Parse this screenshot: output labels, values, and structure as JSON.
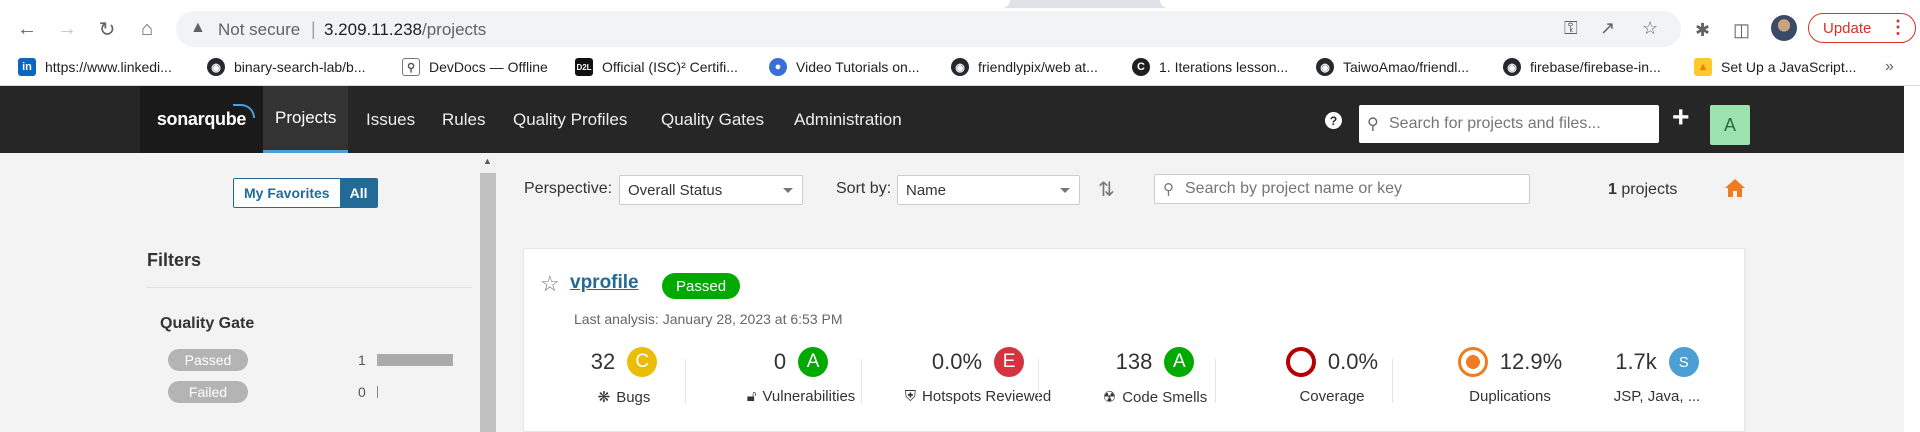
{
  "browser": {
    "security_text": "Not secure",
    "url_host": "3.209.11.238",
    "url_path": "/projects",
    "update_label": "Update"
  },
  "bookmarks": [
    {
      "label": "https://www.linkedi...",
      "icon": "linkedin-icon"
    },
    {
      "label": "binary-search-lab/b...",
      "icon": "github-icon"
    },
    {
      "label": "DevDocs — Offline",
      "icon": "devdocs-icon"
    },
    {
      "label": "Official (ISC)² Certifi...",
      "icon": "d2l-icon"
    },
    {
      "label": "Video Tutorials on...",
      "icon": "globe-icon"
    },
    {
      "label": "friendlypix/web at...",
      "icon": "github-icon"
    },
    {
      "label": "1. Iterations lesson...",
      "icon": "codecademy-icon"
    },
    {
      "label": "TaiwoAmao/friendl...",
      "icon": "github-icon"
    },
    {
      "label": "firebase/firebase-in...",
      "icon": "github-icon"
    },
    {
      "label": "Set Up a JavaScript...",
      "icon": "firebase-icon"
    }
  ],
  "nav": {
    "logo": "sonarqube",
    "items": [
      "Projects",
      "Issues",
      "Rules",
      "Quality Profiles",
      "Quality Gates",
      "Administration"
    ],
    "active": "Projects",
    "search_placeholder": "Search for projects and files...",
    "avatar_letter": "A"
  },
  "sidebar": {
    "favorites_label": "My Favorites",
    "all_label": "All",
    "filters_title": "Filters",
    "quality_gate_title": "Quality Gate",
    "facets": [
      {
        "label": "Passed",
        "count": "1",
        "fraction": 1.0
      },
      {
        "label": "Failed",
        "count": "0",
        "fraction": 0.0
      }
    ]
  },
  "controls": {
    "perspective_label": "Perspective:",
    "perspective_value": "Overall Status",
    "sort_label": "Sort by:",
    "sort_value": "Name",
    "search_placeholder": "Search by project name or key",
    "count": "1",
    "count_suffix": "projects"
  },
  "project": {
    "name": "vprofile",
    "status": "Passed",
    "last_analysis": "Last analysis: January 28, 2023 at 6:53 PM",
    "metrics": [
      {
        "value": "32",
        "rating": "C",
        "rating_color": "#eabe06",
        "label": "Bugs",
        "icon": "bug-icon"
      },
      {
        "value": "0",
        "rating": "A",
        "rating_color": "#00aa00",
        "label": "Vulnerabilities",
        "icon": "lock-icon"
      },
      {
        "value": "0.0%",
        "rating": "E",
        "rating_color": "#d4333f",
        "label": "Hotspots Reviewed",
        "icon": "shield-icon"
      },
      {
        "value": "138",
        "rating": "A",
        "rating_color": "#00aa00",
        "label": "Code Smells",
        "icon": "code-smell-icon"
      },
      {
        "value": "0.0%",
        "rating": "",
        "rating_color": "#b30000",
        "label": "Coverage",
        "icon": "coverage-ring-icon"
      },
      {
        "value": "12.9%",
        "rating": "",
        "rating_color": "#ed7d20",
        "label": "Duplications",
        "icon": "duplications-ring-icon"
      },
      {
        "value": "1.7k",
        "rating": "S",
        "rating_color": "#4b9fd5",
        "label": "JSP, Java, ...",
        "icon": ""
      }
    ]
  }
}
